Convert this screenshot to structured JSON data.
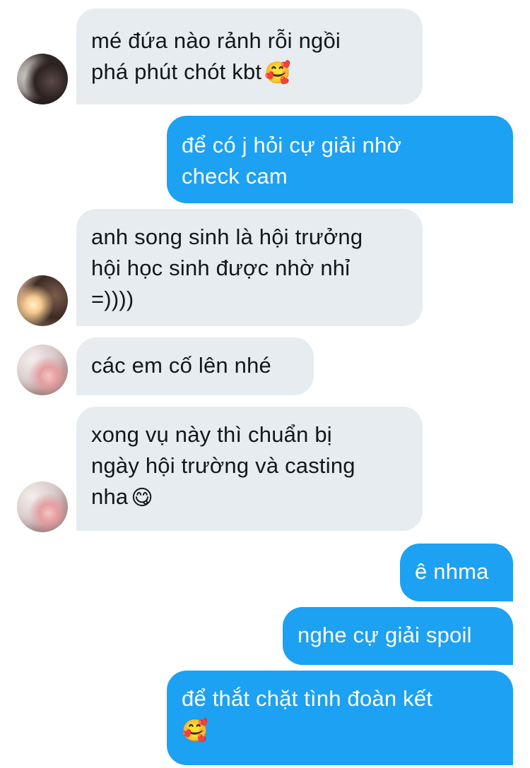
{
  "messages": [
    {
      "direction": "incoming",
      "lines": [
        "mé đứa nào rảnh rỗi ngồi",
        "phá phút chót kbt"
      ],
      "emoji": "🥰",
      "emoji_name": "smiling-face-with-hearts"
    },
    {
      "direction": "outgoing",
      "lines": [
        "để có j hỏi cự giải nhờ",
        "check cam"
      ]
    },
    {
      "direction": "incoming",
      "lines": [
        "anh song sinh là hội trưởng",
        "hội học sinh được nhờ nhỉ",
        "=))))"
      ]
    },
    {
      "direction": "incoming",
      "lines": [
        "các em cố lên nhé"
      ]
    },
    {
      "direction": "incoming",
      "lines": [
        "xong vụ này thì chuẩn bị",
        "ngày hội trường và casting",
        "nha"
      ],
      "emoji": "😋",
      "emoji_name": "face-savoring-food"
    },
    {
      "direction": "outgoing",
      "lines": [
        "ê nhma"
      ]
    },
    {
      "direction": "outgoing",
      "lines": [
        "nghe cự giải spoil"
      ]
    },
    {
      "direction": "outgoing",
      "lines": [
        "để thắt chặt tình đoàn kết"
      ],
      "emoji": "🥰",
      "emoji_name": "smiling-face-with-hearts"
    }
  ],
  "colors": {
    "incoming_bubble": "#e6ecf0",
    "incoming_text": "#14171a",
    "outgoing_bubble": "#1da1f2",
    "outgoing_text": "#ffffff",
    "background": "#ffffff"
  }
}
